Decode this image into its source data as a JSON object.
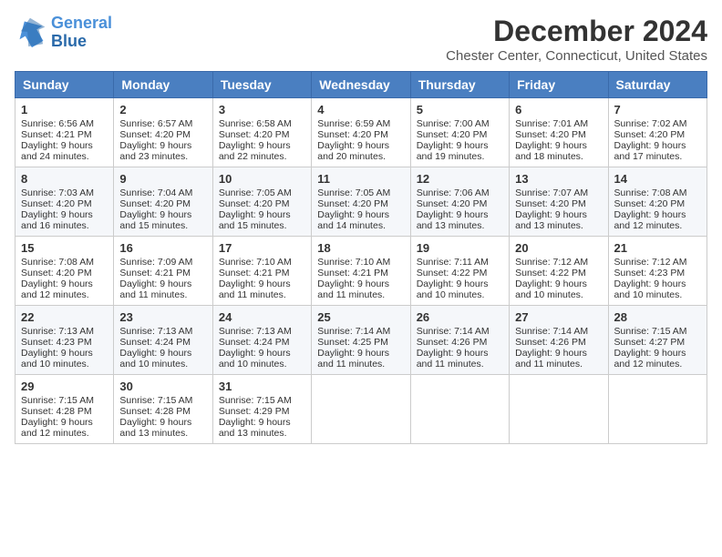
{
  "header": {
    "logo_line1": "General",
    "logo_line2": "Blue",
    "main_title": "December 2024",
    "subtitle": "Chester Center, Connecticut, United States"
  },
  "days_of_week": [
    "Sunday",
    "Monday",
    "Tuesday",
    "Wednesday",
    "Thursday",
    "Friday",
    "Saturday"
  ],
  "weeks": [
    [
      {
        "day": "1",
        "sunrise": "Sunrise: 6:56 AM",
        "sunset": "Sunset: 4:21 PM",
        "daylight": "Daylight: 9 hours and 24 minutes."
      },
      {
        "day": "2",
        "sunrise": "Sunrise: 6:57 AM",
        "sunset": "Sunset: 4:20 PM",
        "daylight": "Daylight: 9 hours and 23 minutes."
      },
      {
        "day": "3",
        "sunrise": "Sunrise: 6:58 AM",
        "sunset": "Sunset: 4:20 PM",
        "daylight": "Daylight: 9 hours and 22 minutes."
      },
      {
        "day": "4",
        "sunrise": "Sunrise: 6:59 AM",
        "sunset": "Sunset: 4:20 PM",
        "daylight": "Daylight: 9 hours and 20 minutes."
      },
      {
        "day": "5",
        "sunrise": "Sunrise: 7:00 AM",
        "sunset": "Sunset: 4:20 PM",
        "daylight": "Daylight: 9 hours and 19 minutes."
      },
      {
        "day": "6",
        "sunrise": "Sunrise: 7:01 AM",
        "sunset": "Sunset: 4:20 PM",
        "daylight": "Daylight: 9 hours and 18 minutes."
      },
      {
        "day": "7",
        "sunrise": "Sunrise: 7:02 AM",
        "sunset": "Sunset: 4:20 PM",
        "daylight": "Daylight: 9 hours and 17 minutes."
      }
    ],
    [
      {
        "day": "8",
        "sunrise": "Sunrise: 7:03 AM",
        "sunset": "Sunset: 4:20 PM",
        "daylight": "Daylight: 9 hours and 16 minutes."
      },
      {
        "day": "9",
        "sunrise": "Sunrise: 7:04 AM",
        "sunset": "Sunset: 4:20 PM",
        "daylight": "Daylight: 9 hours and 15 minutes."
      },
      {
        "day": "10",
        "sunrise": "Sunrise: 7:05 AM",
        "sunset": "Sunset: 4:20 PM",
        "daylight": "Daylight: 9 hours and 15 minutes."
      },
      {
        "day": "11",
        "sunrise": "Sunrise: 7:05 AM",
        "sunset": "Sunset: 4:20 PM",
        "daylight": "Daylight: 9 hours and 14 minutes."
      },
      {
        "day": "12",
        "sunrise": "Sunrise: 7:06 AM",
        "sunset": "Sunset: 4:20 PM",
        "daylight": "Daylight: 9 hours and 13 minutes."
      },
      {
        "day": "13",
        "sunrise": "Sunrise: 7:07 AM",
        "sunset": "Sunset: 4:20 PM",
        "daylight": "Daylight: 9 hours and 13 minutes."
      },
      {
        "day": "14",
        "sunrise": "Sunrise: 7:08 AM",
        "sunset": "Sunset: 4:20 PM",
        "daylight": "Daylight: 9 hours and 12 minutes."
      }
    ],
    [
      {
        "day": "15",
        "sunrise": "Sunrise: 7:08 AM",
        "sunset": "Sunset: 4:20 PM",
        "daylight": "Daylight: 9 hours and 12 minutes."
      },
      {
        "day": "16",
        "sunrise": "Sunrise: 7:09 AM",
        "sunset": "Sunset: 4:21 PM",
        "daylight": "Daylight: 9 hours and 11 minutes."
      },
      {
        "day": "17",
        "sunrise": "Sunrise: 7:10 AM",
        "sunset": "Sunset: 4:21 PM",
        "daylight": "Daylight: 9 hours and 11 minutes."
      },
      {
        "day": "18",
        "sunrise": "Sunrise: 7:10 AM",
        "sunset": "Sunset: 4:21 PM",
        "daylight": "Daylight: 9 hours and 11 minutes."
      },
      {
        "day": "19",
        "sunrise": "Sunrise: 7:11 AM",
        "sunset": "Sunset: 4:22 PM",
        "daylight": "Daylight: 9 hours and 10 minutes."
      },
      {
        "day": "20",
        "sunrise": "Sunrise: 7:12 AM",
        "sunset": "Sunset: 4:22 PM",
        "daylight": "Daylight: 9 hours and 10 minutes."
      },
      {
        "day": "21",
        "sunrise": "Sunrise: 7:12 AM",
        "sunset": "Sunset: 4:23 PM",
        "daylight": "Daylight: 9 hours and 10 minutes."
      }
    ],
    [
      {
        "day": "22",
        "sunrise": "Sunrise: 7:13 AM",
        "sunset": "Sunset: 4:23 PM",
        "daylight": "Daylight: 9 hours and 10 minutes."
      },
      {
        "day": "23",
        "sunrise": "Sunrise: 7:13 AM",
        "sunset": "Sunset: 4:24 PM",
        "daylight": "Daylight: 9 hours and 10 minutes."
      },
      {
        "day": "24",
        "sunrise": "Sunrise: 7:13 AM",
        "sunset": "Sunset: 4:24 PM",
        "daylight": "Daylight: 9 hours and 10 minutes."
      },
      {
        "day": "25",
        "sunrise": "Sunrise: 7:14 AM",
        "sunset": "Sunset: 4:25 PM",
        "daylight": "Daylight: 9 hours and 11 minutes."
      },
      {
        "day": "26",
        "sunrise": "Sunrise: 7:14 AM",
        "sunset": "Sunset: 4:26 PM",
        "daylight": "Daylight: 9 hours and 11 minutes."
      },
      {
        "day": "27",
        "sunrise": "Sunrise: 7:14 AM",
        "sunset": "Sunset: 4:26 PM",
        "daylight": "Daylight: 9 hours and 11 minutes."
      },
      {
        "day": "28",
        "sunrise": "Sunrise: 7:15 AM",
        "sunset": "Sunset: 4:27 PM",
        "daylight": "Daylight: 9 hours and 12 minutes."
      }
    ],
    [
      {
        "day": "29",
        "sunrise": "Sunrise: 7:15 AM",
        "sunset": "Sunset: 4:28 PM",
        "daylight": "Daylight: 9 hours and 12 minutes."
      },
      {
        "day": "30",
        "sunrise": "Sunrise: 7:15 AM",
        "sunset": "Sunset: 4:28 PM",
        "daylight": "Daylight: 9 hours and 13 minutes."
      },
      {
        "day": "31",
        "sunrise": "Sunrise: 7:15 AM",
        "sunset": "Sunset: 4:29 PM",
        "daylight": "Daylight: 9 hours and 13 minutes."
      },
      null,
      null,
      null,
      null
    ]
  ]
}
